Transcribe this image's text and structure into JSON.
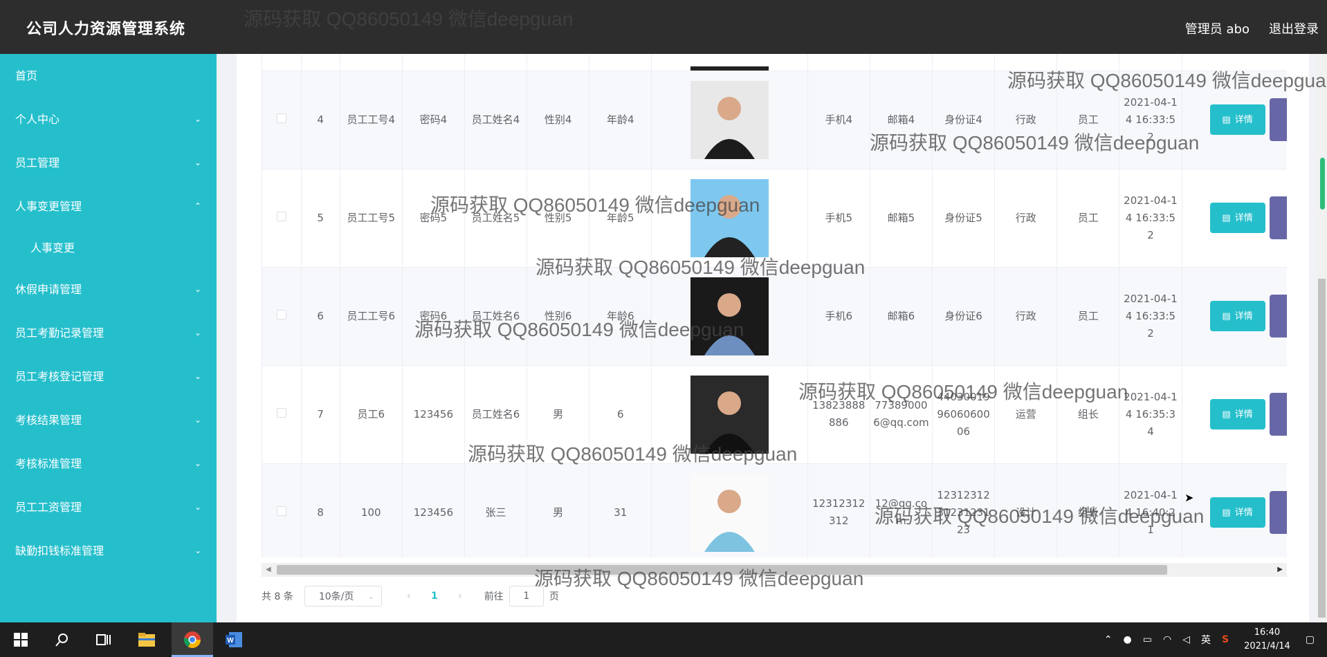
{
  "header": {
    "title": "公司人力资源管理系统",
    "user": "管理员 abo",
    "logout": "退出登录"
  },
  "sidebar": {
    "items": [
      {
        "label": "首页",
        "chevron": ""
      },
      {
        "label": "个人中心",
        "chevron": "⌄"
      },
      {
        "label": "员工管理",
        "chevron": "⌄"
      },
      {
        "label": "人事变更管理",
        "chevron": "⌃"
      },
      {
        "label": "人事变更",
        "chevron": ""
      },
      {
        "label": "休假申请管理",
        "chevron": "⌄"
      },
      {
        "label": "员工考勤记录管理",
        "chevron": "⌄"
      },
      {
        "label": "员工考核登记管理",
        "chevron": "⌄"
      },
      {
        "label": "考核结果管理",
        "chevron": "⌄"
      },
      {
        "label": "考核标准管理",
        "chevron": "⌄"
      },
      {
        "label": "员工工资管理",
        "chevron": "⌄"
      },
      {
        "label": "缺勤扣钱标准管理",
        "chevron": "⌄"
      }
    ]
  },
  "table": {
    "detail_label": "详情",
    "rows": [
      {
        "index": "4",
        "emp_no": "员工工号4",
        "password": "密码4",
        "name": "员工姓名4",
        "gender": "性别4",
        "age": "年龄4",
        "photo": "portrait-man-dark-suit",
        "phone": "手机4",
        "email": "邮箱4",
        "id_card": "身份证4",
        "dept": "行政",
        "position": "员工",
        "time": "2021-04-14 16:33:52"
      },
      {
        "index": "5",
        "emp_no": "员工工号5",
        "password": "密码5",
        "name": "员工姓名5",
        "gender": "性别5",
        "age": "年龄5",
        "photo": "portrait-woman-blue-background",
        "phone": "手机5",
        "email": "邮箱5",
        "id_card": "身份证5",
        "dept": "行政",
        "position": "员工",
        "time": "2021-04-14 16:33:52"
      },
      {
        "index": "6",
        "emp_no": "员工工号6",
        "password": "密码6",
        "name": "员工姓名6",
        "gender": "性别6",
        "age": "年龄6",
        "photo": "portrait-man-blue-shirt",
        "phone": "手机6",
        "email": "邮箱6",
        "id_card": "身份证6",
        "dept": "行政",
        "position": "员工",
        "time": "2021-04-14 16:33:52"
      },
      {
        "index": "7",
        "emp_no": "员工6",
        "password": "123456",
        "name": "员工姓名6",
        "gender": "男",
        "age": "6",
        "photo": "portrait-man-seated",
        "phone": "13823888886",
        "email": "773890006@qq.com",
        "id_card": "440300199606060006",
        "dept": "运营",
        "position": "组长",
        "time": "2021-04-14 16:35:34"
      },
      {
        "index": "8",
        "emp_no": "100",
        "password": "123456",
        "name": "张三",
        "gender": "男",
        "age": "31",
        "photo": "abstract-swirl-artwork",
        "phone": "12312312312",
        "email": "12@qq.com",
        "id_card": "123123123123123123",
        "dept": "设计",
        "position": "组长",
        "time": "2021-04-14 16:40:21"
      }
    ]
  },
  "pagination": {
    "total": "共 8 条",
    "page_size": "10条/页",
    "prev": "‹",
    "current": "1",
    "next": "›",
    "goto_label": "前往",
    "goto_value": "1",
    "page_suffix": "页"
  },
  "watermark": "源码获取 QQ86050149 微信deepguan",
  "taskbar": {
    "ime": "英",
    "time": "16:40",
    "date": "2021/4/14"
  },
  "colors": {
    "accent": "#25bfcc",
    "header_bg": "#2d2d2d",
    "edit_button": "#6767a8"
  }
}
